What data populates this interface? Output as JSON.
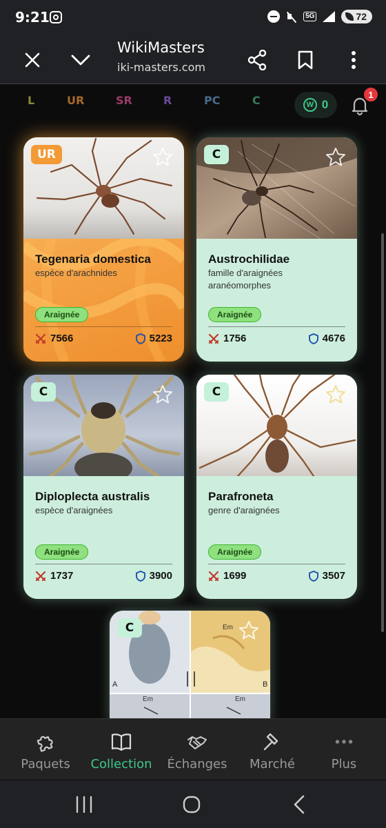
{
  "status_bar": {
    "time": "9:21",
    "network": "5G",
    "battery": "72"
  },
  "toolbar": {
    "title": "WikiMasters",
    "url": "iki-masters.com"
  },
  "rarity_filters": [
    {
      "label": "L",
      "color": "#8a8a3a"
    },
    {
      "label": "UR",
      "color": "#a8672a"
    },
    {
      "label": "SR",
      "color": "#9a3a6a"
    },
    {
      "label": "R",
      "color": "#6a4a9a"
    },
    {
      "label": "PC",
      "color": "#4a6a8a"
    },
    {
      "label": "C",
      "color": "#3a7a5a"
    }
  ],
  "coins": {
    "count": "0",
    "symbol": "W"
  },
  "notifications": {
    "count": "1"
  },
  "cards": [
    {
      "rarity": "UR",
      "name": "Tegenaria domestica",
      "description": "espèce d'arachnides",
      "tag": "Araignée",
      "attack": "7566",
      "defense": "5223"
    },
    {
      "rarity": "C",
      "name": "Austrochilidae",
      "description": "famille d'araignées aranéomorphes",
      "tag": "Araignée",
      "attack": "1756",
      "defense": "4676"
    },
    {
      "rarity": "C",
      "name": "Diploplecta australis",
      "description": "espèce d'araignées",
      "tag": "Araignée",
      "attack": "1737",
      "defense": "3900"
    },
    {
      "rarity": "C",
      "name": "Parafroneta",
      "description": "genre d'araignées",
      "tag": "Araignée",
      "attack": "1699",
      "defense": "3507"
    }
  ],
  "partial_card": {
    "rarity": "C",
    "panel_a": "A",
    "panel_b": "B",
    "label_em": "Em"
  },
  "bottom_nav": [
    {
      "label": "Paquets",
      "icon": "puzzle-icon",
      "active": false
    },
    {
      "label": "Collection",
      "icon": "book-icon",
      "active": true
    },
    {
      "label": "Échanges",
      "icon": "handshake-icon",
      "active": false
    },
    {
      "label": "Marché",
      "icon": "gavel-icon",
      "active": false
    },
    {
      "label": "Plus",
      "icon": "more-dots-icon",
      "active": false
    }
  ],
  "colors": {
    "accent": "#3ec98a",
    "ur_card": "#f6a64a",
    "common_card": "#cdeedd",
    "tag_green": "#8fe07e",
    "badge_red": "#e5383b"
  }
}
